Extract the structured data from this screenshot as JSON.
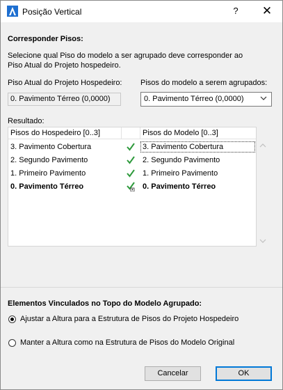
{
  "window": {
    "title": "Posição Vertical",
    "help_label": "?",
    "close_label": "✕"
  },
  "match": {
    "heading": "Corresponder Pisos:",
    "description_line1": "Selecione qual Piso do modelo a ser agrupado deve corresponder ao",
    "description_line2": "Piso Atual do Projeto hospedeiro."
  },
  "host_story": {
    "label": "Piso Atual do Projeto Hospedeiro:",
    "value": "0. Pavimento Térreo (0,0000)"
  },
  "model_story": {
    "label": "Pisos do modelo a serem agrupados:",
    "selected": "0. Pavimento Térreo (0,0000)"
  },
  "results": {
    "label": "Resultado:",
    "col_host": "Pisos do Hospedeiro [0..3]",
    "col_model": "Pisos do Modelo [0..3]",
    "rows": [
      {
        "host": "3. Pavimento Cobertura",
        "model": "3. Pavimento Cobertura"
      },
      {
        "host": "2. Segundo Pavimento",
        "model": "2. Segundo Pavimento"
      },
      {
        "host": "1. Primeiro Pavimento",
        "model": "1. Primeiro Pavimento"
      },
      {
        "host": "0. Pavimento Térreo",
        "model": "0. Pavimento Térreo"
      }
    ]
  },
  "linked": {
    "heading": "Elementos Vinculados no Topo do Modelo Agrupado:",
    "option1": "Ajustar a Altura para a Estrutura de Pisos do Projeto Hospedeiro",
    "option2": "Manter a Altura como na Estrutura de Pisos do Modelo Original"
  },
  "buttons": {
    "cancel": "Cancelar",
    "ok": "OK"
  },
  "colors": {
    "check": "#2e9a3c",
    "accent": "#0078d7"
  }
}
